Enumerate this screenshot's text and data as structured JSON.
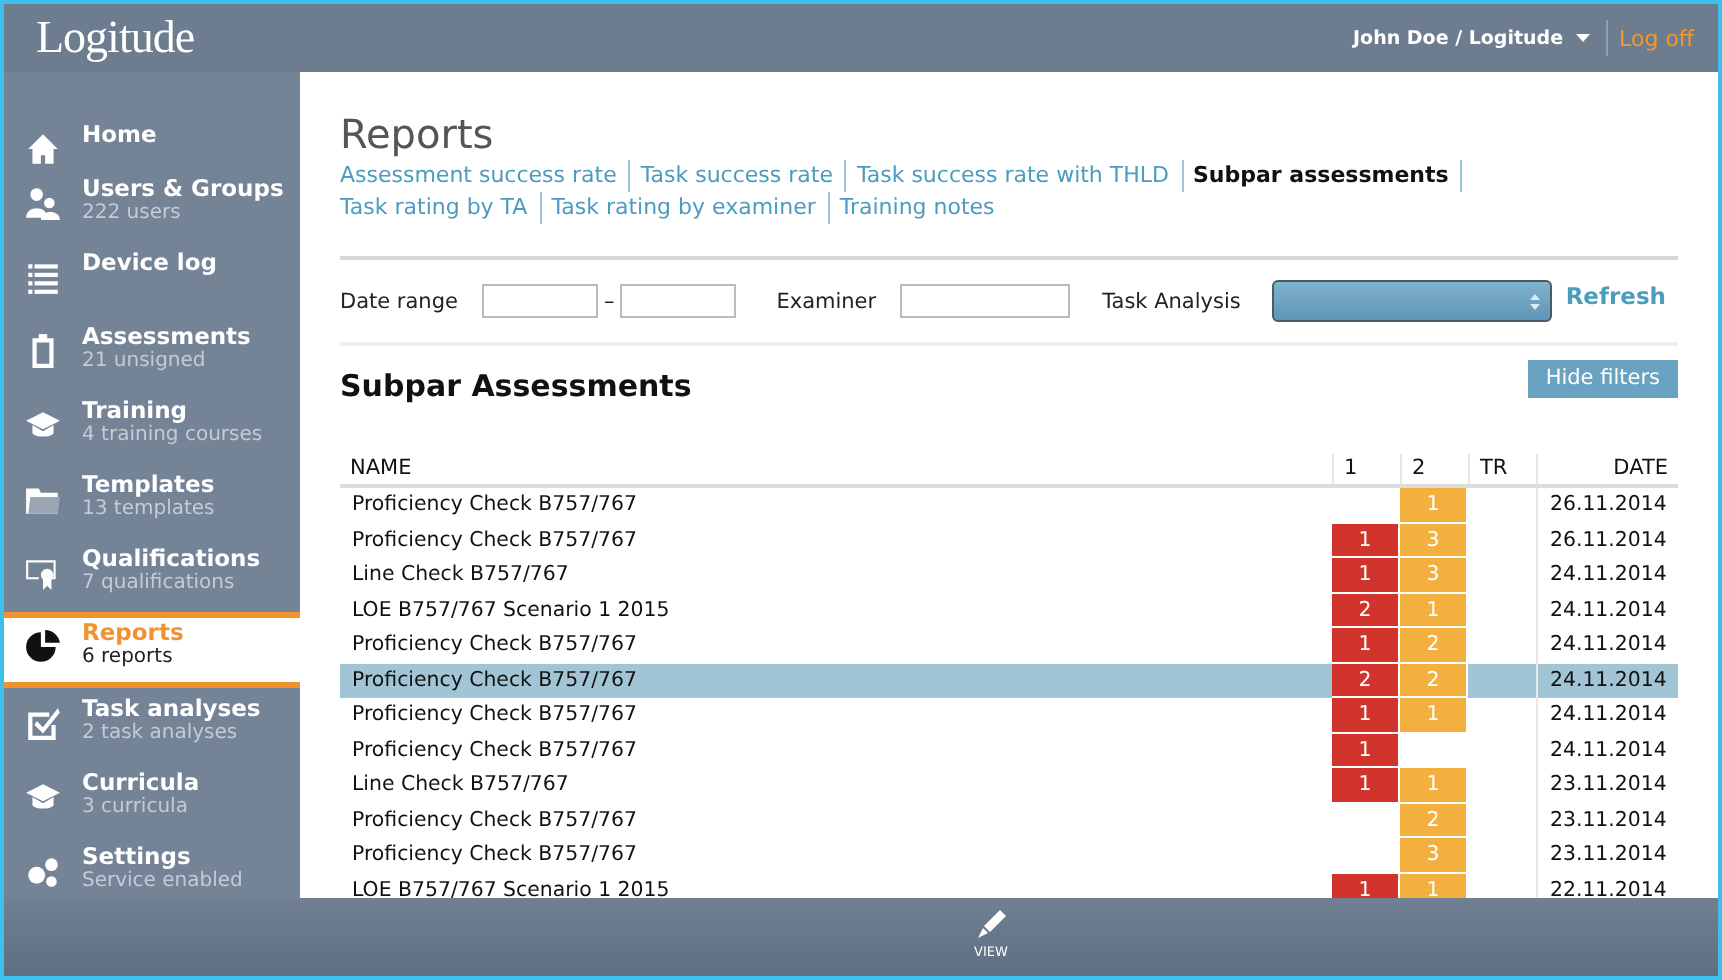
{
  "header": {
    "logo": "Logitude",
    "user": "John Doe / Logitude",
    "logoff": "Log off"
  },
  "sidebar": {
    "items": [
      {
        "title": "Home",
        "selected": false
      },
      {
        "title": "Users & Groups",
        "subtitle": "222 users",
        "selected": false
      },
      {
        "title": "Device log",
        "selected": false
      },
      {
        "title": "Assessments",
        "subtitle": "21 unsigned",
        "selected": false
      },
      {
        "title": "Training",
        "subtitle": "4 training courses",
        "selected": false
      },
      {
        "title": "Templates",
        "subtitle": "13 templates",
        "selected": false
      },
      {
        "title": "Qualifications",
        "subtitle": "7 qualifications",
        "selected": false
      },
      {
        "title": "Reports",
        "subtitle": "6 reports",
        "selected": true
      },
      {
        "title": "Task analyses",
        "subtitle": "2 task analyses",
        "selected": false
      },
      {
        "title": "Curricula",
        "subtitle": "3 curricula",
        "selected": false
      },
      {
        "title": "Settings",
        "subtitle": "Service enabled",
        "selected": false
      }
    ]
  },
  "page": {
    "title": "Reports",
    "links": [
      {
        "label": "Assessment success rate",
        "selected": false
      },
      {
        "label": "Task success rate",
        "selected": false
      },
      {
        "label": "Task success rate with THLD",
        "selected": false
      },
      {
        "label": "Subpar assessments",
        "selected": true
      },
      {
        "label": "Task rating by TA",
        "selected": false
      },
      {
        "label": "Task rating by examiner",
        "selected": false
      },
      {
        "label": "Training notes",
        "selected": false
      }
    ],
    "filters": {
      "date_label": "Date range",
      "date_separator": "–",
      "examiner_label": "Examiner",
      "task_analysis_label": "Task Analysis",
      "refresh": "Refresh"
    },
    "section_title": "Subpar Assessments",
    "hide_filters": "Hide filters",
    "table": {
      "columns": [
        "NAME",
        "1",
        "2",
        "TR",
        "DATE"
      ],
      "rows": [
        {
          "name": "Proficiency Check B757/767",
          "col_2": "1",
          "date": "26.11.2014",
          "selected": false
        },
        {
          "name": "Proficiency Check B757/767",
          "col_1": "1",
          "col_2": "3",
          "date": "26.11.2014",
          "selected": false
        },
        {
          "name": "Line Check B757/767",
          "col_1": "1",
          "col_2": "3",
          "date": "24.11.2014",
          "selected": false
        },
        {
          "name": "LOE B757/767 Scenario 1 2015",
          "col_1": "2",
          "col_2": "1",
          "date": "24.11.2014",
          "selected": false
        },
        {
          "name": "Proficiency Check B757/767",
          "col_1": "1",
          "col_2": "2",
          "date": "24.11.2014",
          "selected": false
        },
        {
          "name": "Proficiency Check B757/767",
          "col_1": "2",
          "col_2": "2",
          "date": "24.11.2014",
          "selected": true
        },
        {
          "name": "Proficiency Check B757/767",
          "col_1": "1",
          "col_2": "1",
          "date": "24.11.2014",
          "selected": false
        },
        {
          "name": "Proficiency Check B757/767",
          "col_1": "1",
          "date": "24.11.2014",
          "selected": false
        },
        {
          "name": "Line Check B757/767",
          "col_1": "1",
          "col_2": "1",
          "date": "23.11.2014",
          "selected": false
        },
        {
          "name": "Proficiency Check B757/767",
          "col_2": "2",
          "date": "23.11.2014",
          "selected": false
        },
        {
          "name": "Proficiency Check B757/767",
          "col_2": "3",
          "date": "23.11.2014",
          "selected": false
        },
        {
          "name": "LOE B757/767 Scenario 1 2015",
          "col_1": "1",
          "col_2": "1",
          "date": "22.11.2014",
          "selected": false
        }
      ]
    }
  },
  "toolbar": {
    "buttons": [
      {
        "label": "VIEW"
      }
    ]
  }
}
